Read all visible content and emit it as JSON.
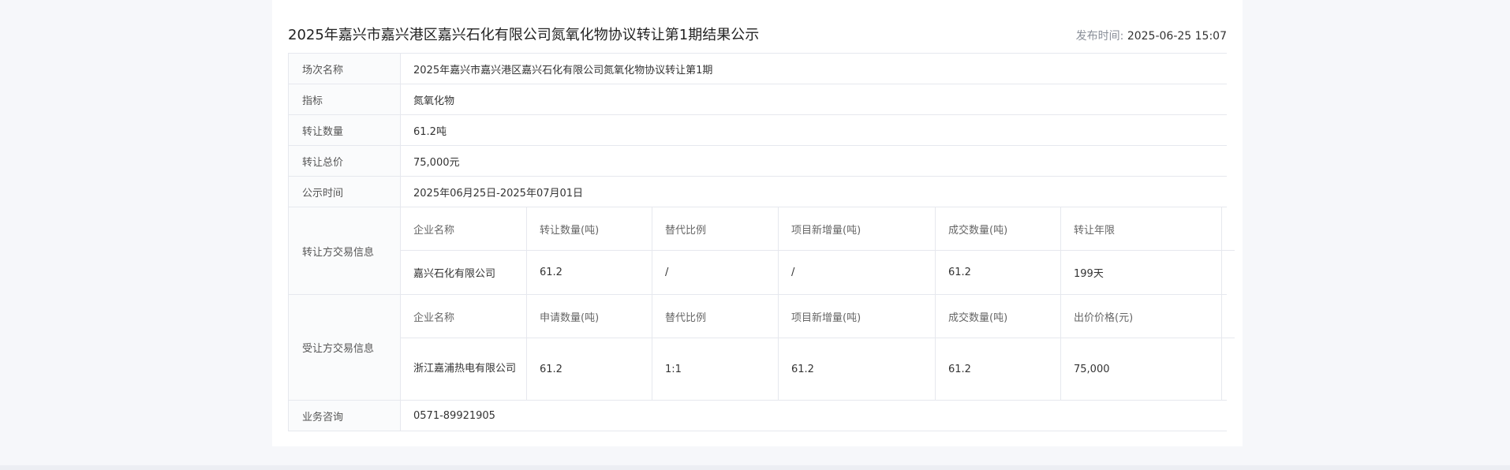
{
  "header": {
    "title": "2025年嘉兴市嘉兴港区嘉兴石化有限公司氮氧化物协议转让第1期结果公示",
    "publish_label": "发布时间:",
    "publish_value": "2025-06-25 15:07"
  },
  "info": {
    "session_label": "场次名称",
    "session_value": "2025年嘉兴市嘉兴港区嘉兴石化有限公司氮氧化物协议转让第1期",
    "indicator_label": "指标",
    "indicator_value": "氮氧化物",
    "quantity_label": "转让数量",
    "quantity_value": "61.2吨",
    "total_label": "转让总价",
    "total_value": "75,000元",
    "period_label": "公示时间",
    "period_value": "2025年06月25日-2025年07月01日",
    "consult_label": "业务咨询",
    "consult_value": "0571-89921905"
  },
  "transferor": {
    "label": "转让方交易信息",
    "headers": [
      "企业名称",
      "转让数量(吨)",
      "替代比例",
      "项目新增量(吨)",
      "成交数量(吨)",
      "转让年限",
      ""
    ],
    "values": [
      "嘉兴石化有限公司",
      "61.2",
      "/",
      "/",
      "61.2",
      "199天",
      ""
    ]
  },
  "transferee": {
    "label": "受让方交易信息",
    "headers": [
      "企业名称",
      "申请数量(吨)",
      "替代比例",
      "项目新增量(吨)",
      "成交数量(吨)",
      "出价价格(元)",
      ""
    ],
    "values": [
      "浙江嘉浦热电有限公司",
      "61.2",
      "1:1",
      "61.2",
      "61.2",
      "75,000",
      ""
    ]
  }
}
